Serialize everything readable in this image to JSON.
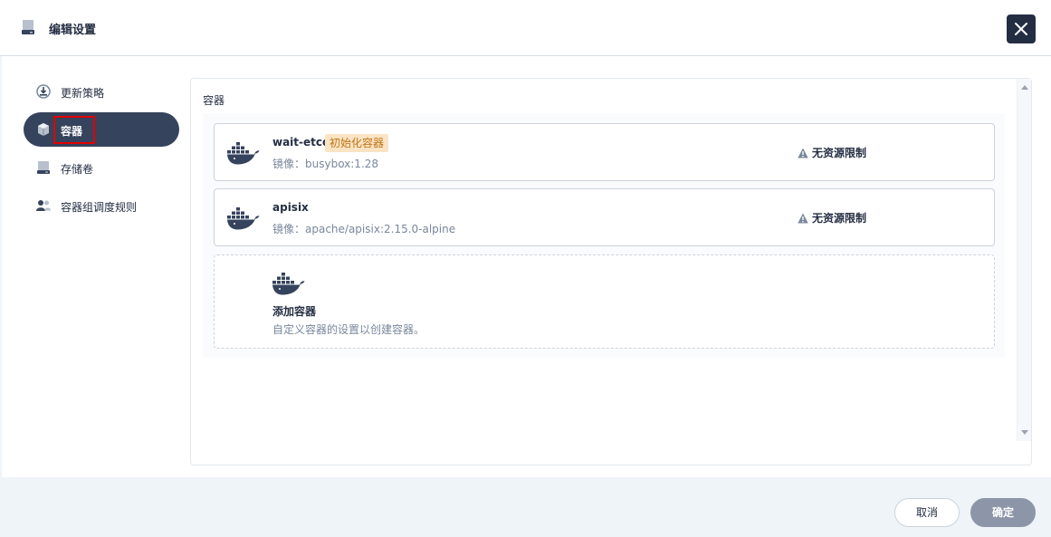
{
  "header": {
    "title": "编辑设置",
    "icon": "storage-icon",
    "close_icon": "close-icon"
  },
  "nav": {
    "items": [
      {
        "label": "更新策略",
        "icon": "update-strategy-icon",
        "active": false
      },
      {
        "label": "容器",
        "icon": "container-icon",
        "active": true
      },
      {
        "label": "存储卷",
        "icon": "volume-icon",
        "active": false
      },
      {
        "label": "容器组调度规则",
        "icon": "scheduling-icon",
        "active": false
      }
    ]
  },
  "panel": {
    "title": "容器",
    "containers": [
      {
        "name": "wait-etcd",
        "tag": "初始化容器",
        "image": "镜像：busybox:1.28",
        "limit": "无资源限制",
        "icon": "docker-icon"
      },
      {
        "name": "apisix",
        "tag": "",
        "image": "镜像：apache/apisix:2.15.0-alpine",
        "limit": "无资源限制",
        "icon": "docker-icon"
      }
    ],
    "add": {
      "title": "添加容器",
      "description": "自定义容器的设置以创建容器。",
      "icon": "docker-icon"
    }
  },
  "footer": {
    "cancel_label": "取消",
    "ok_label": "确定"
  },
  "colors": {
    "primary_dark": "#242e42",
    "active_nav": "#36435c",
    "tag_bg": "#fae4c4",
    "tag_text": "#c07416",
    "highlight": "#e30000"
  }
}
